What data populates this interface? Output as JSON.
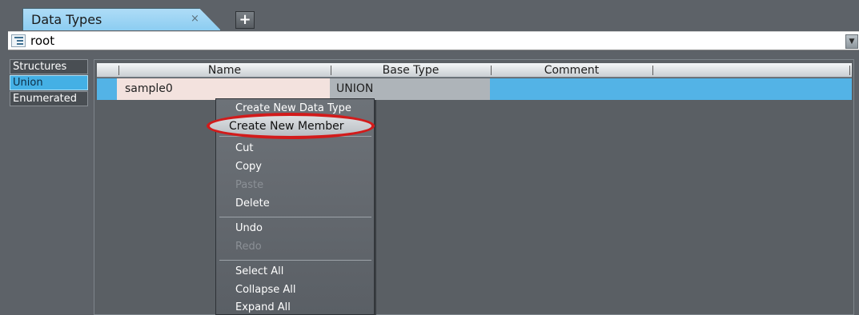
{
  "tab": {
    "title": "Data Types",
    "close_glyph": "×",
    "add_glyph": "+"
  },
  "root": {
    "label": "root",
    "dropdown_glyph": "▼"
  },
  "categories": [
    {
      "label": "Structures"
    },
    {
      "label": "Union"
    },
    {
      "label": "Enumerated"
    }
  ],
  "selected_category": "Union",
  "grid": {
    "columns": [
      "Name",
      "Base Type",
      "Comment"
    ],
    "rows": [
      {
        "name": "sample0",
        "base_type": "UNION",
        "comment": ""
      }
    ]
  },
  "context_menu": {
    "items": [
      {
        "label": "Create New Data Type",
        "enabled": true
      },
      {
        "label": "Create New Member",
        "enabled": true,
        "highlighted": true
      },
      {
        "label": "Cut",
        "enabled": true
      },
      {
        "label": "Copy",
        "enabled": true
      },
      {
        "label": "Paste",
        "enabled": false
      },
      {
        "label": "Delete",
        "enabled": true
      },
      {
        "label": "Undo",
        "enabled": true
      },
      {
        "label": "Redo",
        "enabled": false
      },
      {
        "label": "Select All",
        "enabled": true
      },
      {
        "label": "Collapse All",
        "enabled": true
      },
      {
        "label": "Expand All",
        "enabled": true
      }
    ]
  },
  "colors": {
    "background": "#5d6268",
    "selection": "#53b3e6",
    "highlight_ring": "#d21b1b"
  }
}
